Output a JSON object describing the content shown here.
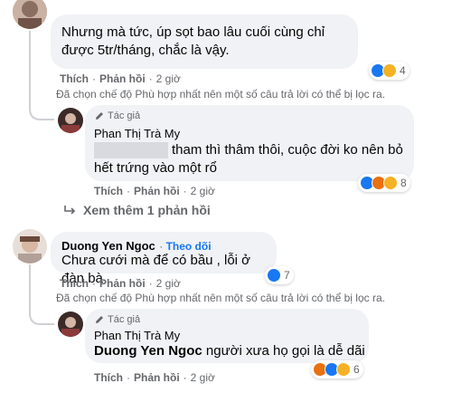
{
  "colors": {
    "bubble": "#f0f2f5",
    "meta_text": "#65676b",
    "link_blue": "#1877f2",
    "like": "#1877f2",
    "haha": "#f7b125",
    "angry": "#e9710f"
  },
  "comments": [
    {
      "text": "Nhưng mà tức, úp sọt bao lâu cuối cùng chỉ được 5tr/tháng, chắc là vậy.",
      "like_label": "Thích",
      "reply_label": "Phản hồi",
      "time": "2 giờ",
      "reaction_icons": [
        "like-icon",
        "haha-icon"
      ],
      "reaction_count": "4",
      "filter_note": "Đã chọn chế độ Phù hợp nhất nên một số câu trả lời có thể bị lọc ra.",
      "reply": {
        "badge": "Tác giả",
        "author": "Phan Thị Trà My",
        "text": "tham thì thâm thôi, cuộc đời ko nên bỏ hết trứng vào một rổ",
        "like_label": "Thích",
        "reply_label": "Phản hồi",
        "time": "2 giờ",
        "reaction_icons": [
          "like-icon",
          "angry-icon",
          "haha-icon"
        ],
        "reaction_count": "8"
      }
    },
    {
      "more_replies": "Xem thêm 1 phản hồi"
    },
    {
      "author": "Duong Yen Ngoc",
      "follow_label": "Theo dõi",
      "text": "Chưa cưới mà để có bầu , lỗi ở đàn bà",
      "like_label": "Thích",
      "reply_label": "Phản hồi",
      "time": "2 giờ",
      "reaction_icons": [
        "like-icon"
      ],
      "reaction_count": "7",
      "filter_note": "Đã chọn chế độ Phù hợp nhất nên một số câu trả lời có thể bị lọc ra.",
      "reply": {
        "badge": "Tác giả",
        "author": "Phan Thị Trà My",
        "mention": "Duong Yen Ngoc",
        "text": "người xưa họ gọi là dễ dãi",
        "like_label": "Thích",
        "reply_label": "Phản hồi",
        "time": "2 giờ",
        "reaction_icons": [
          "angry-icon",
          "like-icon",
          "haha-icon"
        ],
        "reaction_count": "6"
      }
    }
  ]
}
